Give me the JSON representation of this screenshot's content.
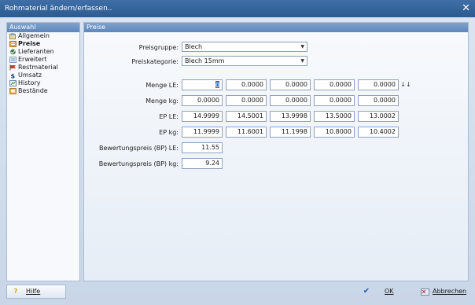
{
  "window": {
    "title": "Rohmaterial ändern/erfassen..",
    "close_glyph": "✕"
  },
  "sidebar": {
    "header": "Auswahl",
    "items": [
      {
        "label": "Allgemein",
        "icon": "general-icon",
        "active": false
      },
      {
        "label": "Preise",
        "icon": "prices-icon",
        "active": true
      },
      {
        "label": "Lieferanten",
        "icon": "suppliers-icon",
        "active": false
      },
      {
        "label": "Erweitert",
        "icon": "extended-icon",
        "active": false
      },
      {
        "label": "Restmaterial",
        "icon": "remnant-icon",
        "active": false
      },
      {
        "label": "Umsatz",
        "icon": "dollar-icon",
        "active": false
      },
      {
        "label": "History",
        "icon": "history-icon",
        "active": false
      },
      {
        "label": "Bestände",
        "icon": "stock-icon",
        "active": false
      }
    ]
  },
  "main": {
    "header": "Preise",
    "preisgruppe": {
      "label": "Preisgruppe:",
      "value": "Blech"
    },
    "preiskategorie": {
      "label": "Preiskategorie:",
      "value": "Blech 15mm"
    },
    "rows": [
      {
        "label": "Menge LE:",
        "values": [
          "0",
          "0.0000",
          "0.0000",
          "0.0000",
          "0.0000"
        ]
      },
      {
        "label": "Menge kg:",
        "values": [
          "0.0000",
          "0.0000",
          "0.0000",
          "0.0000",
          "0.0000"
        ]
      },
      {
        "label": "EP LE:",
        "values": [
          "14.9999",
          "14.5001",
          "13.9998",
          "13.5000",
          "13.0002"
        ]
      },
      {
        "label": "EP kg:",
        "values": [
          "11.9999",
          "11.6001",
          "11.1998",
          "10.8000",
          "10.4002"
        ]
      }
    ],
    "bp_le": {
      "label": "Bewertungspreis (BP) LE:",
      "value": "11.55"
    },
    "bp_kg": {
      "label": "Bewertungspreis (BP) kg:",
      "value": "9.24"
    },
    "sort_glyph": "↓↓"
  },
  "footer": {
    "help": {
      "label": "Hilfe",
      "icon": "help-icon",
      "glyph": "?"
    },
    "ok": {
      "label": "OK",
      "icon": "check-icon",
      "glyph": "✔"
    },
    "cancel": {
      "label": "Abbrechen",
      "icon": "cancel-icon"
    }
  },
  "colors": {
    "titlebar": "#2c5a91",
    "panel_header": "#6a90c2",
    "accent": "#3a6fb8"
  }
}
